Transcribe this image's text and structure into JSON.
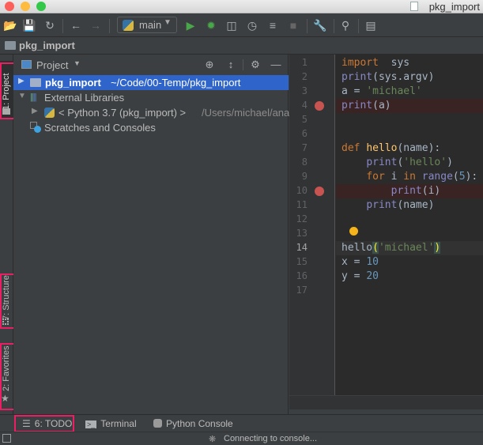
{
  "window": {
    "title": "pkg_import",
    "traffic_lights": {
      "close": "#fc605b",
      "minimize": "#fdbc40",
      "maximize": "#34c84a"
    }
  },
  "toolbar": {
    "buttons": [
      {
        "name": "open-folder-icon"
      },
      {
        "name": "save-icon"
      },
      {
        "name": "sync-icon"
      },
      {
        "name": "back-arrow-icon"
      },
      {
        "name": "forward-arrow-icon"
      },
      {
        "name": "run-icon"
      },
      {
        "name": "debug-icon"
      },
      {
        "name": "run-with-coverage-icon"
      },
      {
        "name": "profile-icon"
      },
      {
        "name": "concurrency-icon"
      },
      {
        "name": "stop-icon"
      },
      {
        "name": "settings-wrench-icon"
      },
      {
        "name": "search-icon"
      },
      {
        "name": "vcs-icon"
      }
    ],
    "run_config": {
      "label": "main",
      "icon": "python-icon"
    }
  },
  "navbar": {
    "breadcrumb": "pkg_import"
  },
  "left_stripe": {
    "tabs": [
      {
        "label": "1: Project",
        "active": true
      },
      {
        "label": "7: Structure",
        "active": false
      },
      {
        "label": "2: Favorites",
        "active": false
      }
    ]
  },
  "project_panel": {
    "title": "Project",
    "header_icons": [
      "locate-icon",
      "collapse-all-icon",
      "gear-icon",
      "minimize-icon"
    ],
    "tree": [
      {
        "label": "pkg_import",
        "path": "~/Code/00-Temp/pkg_import",
        "selected": true,
        "expanded": false
      },
      {
        "label": "External Libraries",
        "expanded": true
      },
      {
        "label": "< Python 3.7 (pkg_import) >",
        "path": "/Users/michael/ana",
        "expanded": false
      },
      {
        "label": "Scratches and Consoles"
      }
    ]
  },
  "editor": {
    "current_line": 14,
    "breakpoints": [
      4,
      10
    ],
    "line_numbers": [
      "1",
      "2",
      "3",
      "4",
      "5",
      "6",
      "7",
      "8",
      "9",
      "10",
      "11",
      "12",
      "13",
      "14",
      "15",
      "16",
      "17"
    ],
    "lines": [
      [
        [
          "kw",
          "import"
        ],
        [
          "",
          "  sys"
        ]
      ],
      [
        [
          "bi",
          "print"
        ],
        [
          "",
          "(sys.argv)"
        ]
      ],
      [
        [
          "",
          "a = "
        ],
        [
          "str",
          "'michael'"
        ]
      ],
      [
        [
          "bi",
          "print"
        ],
        [
          "",
          "(a)"
        ]
      ],
      [],
      [],
      [
        [
          "kw",
          "def "
        ],
        [
          "fn",
          "hello"
        ],
        [
          "",
          "(name):"
        ]
      ],
      [
        [
          "",
          "    "
        ],
        [
          "bi",
          "print"
        ],
        [
          "",
          "("
        ],
        [
          "str",
          "'hello'"
        ],
        [
          "",
          ")"
        ]
      ],
      [
        [
          "",
          "    "
        ],
        [
          "kw",
          "for "
        ],
        [
          "",
          "i "
        ],
        [
          "kw",
          "in "
        ],
        [
          "bi",
          "range"
        ],
        [
          "",
          "("
        ],
        [
          "num",
          "5"
        ],
        [
          "",
          "):"
        ]
      ],
      [
        [
          "",
          "        "
        ],
        [
          "bi",
          "print"
        ],
        [
          "",
          "(i)"
        ]
      ],
      [
        [
          "",
          "    "
        ],
        [
          "bi",
          "print"
        ],
        [
          "",
          "(name)"
        ]
      ],
      [],
      [],
      [
        [
          "",
          "hello"
        ],
        [
          "brace",
          "("
        ],
        [
          "str",
          "'michael'"
        ],
        [
          "brace",
          ")"
        ]
      ],
      [
        [
          "",
          "x = "
        ],
        [
          "num",
          "10"
        ]
      ],
      [
        [
          "",
          "y = "
        ],
        [
          "num",
          "20"
        ]
      ],
      []
    ]
  },
  "bottom_tabs": [
    {
      "label": "6: TODO",
      "icon": "list-icon",
      "highlighted": true
    },
    {
      "label": "Terminal",
      "icon": "terminal-icon"
    },
    {
      "label": "Python Console",
      "icon": "python-icon"
    }
  ],
  "statusbar": {
    "text": "Connecting to console..."
  }
}
